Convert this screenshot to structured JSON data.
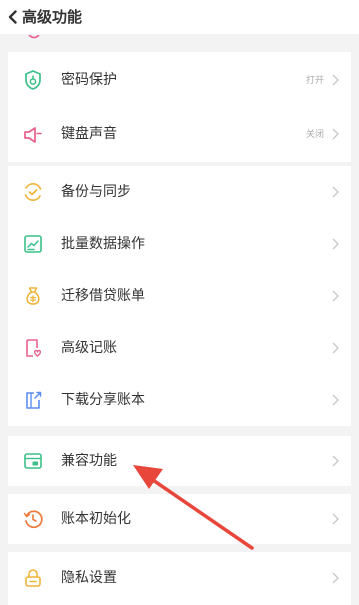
{
  "header": {
    "title": "高级功能",
    "back_icon": "chevron-left-icon"
  },
  "groups": [
    {
      "items": [
        {
          "label": "密码保护",
          "value": "打开",
          "icon": "lock-shield-icon",
          "color": "#3cc08a"
        },
        {
          "label": "键盘声音",
          "value": "关闭",
          "icon": "speaker-icon",
          "color": "#e8608a"
        }
      ]
    },
    {
      "items": [
        {
          "label": "备份与同步",
          "icon": "sync-check-icon",
          "color": "#f0b43a"
        },
        {
          "label": "批量数据操作",
          "icon": "chart-icon",
          "color": "#3cc08a"
        },
        {
          "label": "迁移借贷账单",
          "icon": "money-bag-icon",
          "color": "#f0b43a"
        },
        {
          "label": "高级记账",
          "icon": "book-heart-icon",
          "color": "#e8608a"
        },
        {
          "label": "下载分享账本",
          "icon": "share-book-icon",
          "color": "#5b8def"
        }
      ]
    },
    {
      "items": [
        {
          "label": "兼容功能",
          "icon": "window-icon",
          "color": "#3cc08a"
        }
      ]
    },
    {
      "items": [
        {
          "label": "账本初始化",
          "icon": "clock-reset-icon",
          "color": "#f07a3a"
        }
      ]
    },
    {
      "items": [
        {
          "label": "隐私设置",
          "icon": "padlock-icon",
          "color": "#f0b43a"
        }
      ]
    }
  ],
  "colors": {
    "annotation_arrow": "#e8463a",
    "chevron": "#c8c8c8",
    "background": "#f3f3f3"
  }
}
